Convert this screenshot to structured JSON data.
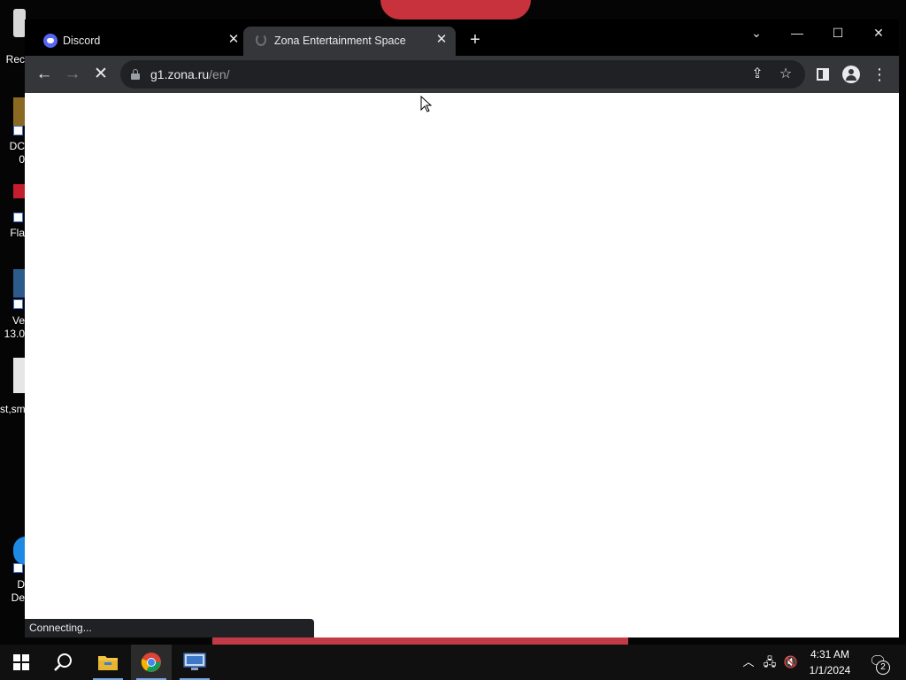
{
  "desktop": {
    "icons": [
      {
        "label": "Rec",
        "extra": ""
      },
      {
        "label": "DC",
        "extra": "0"
      },
      {
        "label": "Fla",
        "extra": ""
      },
      {
        "label": "Ve",
        "extra": "13.0"
      },
      {
        "label": "st,sm",
        "extra": ""
      },
      {
        "label": "D",
        "extra": "De"
      }
    ]
  },
  "browser": {
    "tabs": [
      {
        "title": "Discord",
        "icon": "discord-icon",
        "active": false
      },
      {
        "title": "Zona Entertainment Space",
        "icon": "loading-icon",
        "active": true
      }
    ],
    "address": {
      "host": "g1.zona.ru",
      "path": "/en/"
    },
    "status_text": "Connecting..."
  },
  "taskbar": {
    "apps": [
      {
        "name": "start-icon"
      },
      {
        "name": "search-icon"
      },
      {
        "name": "file-explorer-icon"
      },
      {
        "name": "chrome-icon"
      },
      {
        "name": "remote-desktop-icon"
      }
    ],
    "time": "4:31 AM",
    "date": "1/1/2024",
    "notification_count": "2"
  },
  "colors": {
    "tabstrip_bg": "#000000",
    "toolbar_bg": "#35363a",
    "omnibox_bg": "#202124",
    "taskbar_bg": "#101010"
  }
}
